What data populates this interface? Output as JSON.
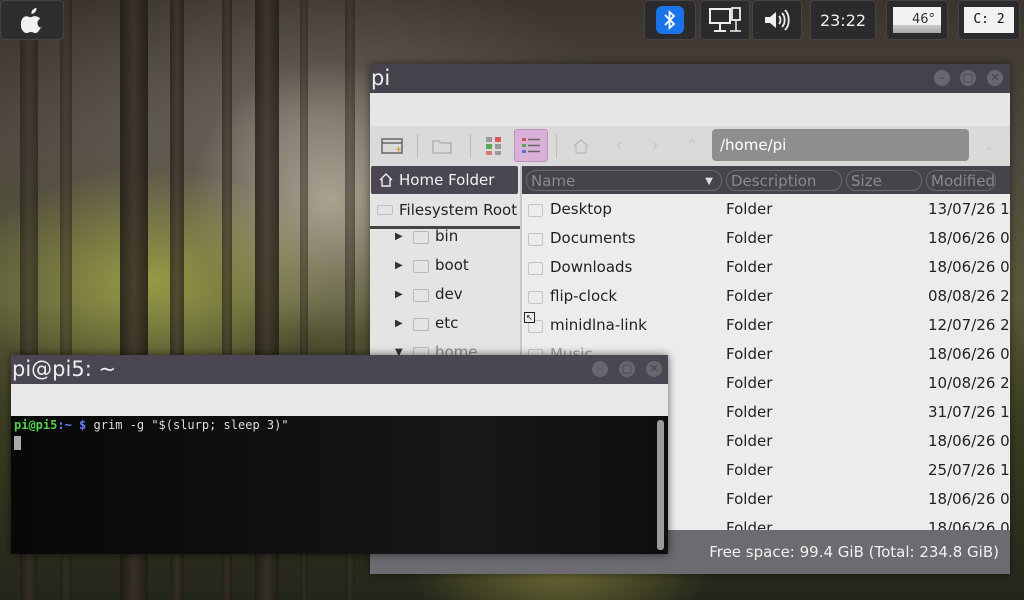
{
  "panel": {
    "menu_icon": "apple-logo-icon",
    "bluetooth_icon": "bluetooth-icon",
    "network_icon": "network-icon",
    "volume_icon": "volume-icon",
    "clock": "23:22",
    "temperature": "46°",
    "cpu_label": "C: 2",
    "accent": "#1a73e8"
  },
  "file_manager": {
    "title": "pi",
    "path": "/home/pi",
    "places": [
      {
        "label": "Home Folder",
        "icon": "home-icon"
      },
      {
        "label": "Filesystem Root",
        "icon": "drive-icon"
      }
    ],
    "tree": [
      {
        "label": "bin"
      },
      {
        "label": "boot"
      },
      {
        "label": "dev"
      },
      {
        "label": "etc"
      },
      {
        "label": "home"
      }
    ],
    "columns": {
      "name": "Name",
      "description": "Description",
      "size": "Size",
      "modified": "Modified"
    },
    "rows": [
      {
        "name": "Desktop",
        "description": "Folder",
        "modified": "13/07/26 1"
      },
      {
        "name": "Documents",
        "description": "Folder",
        "modified": "18/06/26 0"
      },
      {
        "name": "Downloads",
        "description": "Folder",
        "modified": "18/06/26 0"
      },
      {
        "name": "flip-clock",
        "description": "Folder",
        "modified": "08/08/26 2"
      },
      {
        "name": "minidlna-link",
        "description": "Folder",
        "modified": "12/07/26 2"
      },
      {
        "name": "Music",
        "description": "Folder",
        "modified": "18/06/26 0"
      },
      {
        "name": "",
        "description": "Folder",
        "modified": "10/08/26 2"
      },
      {
        "name": "",
        "description": "Folder",
        "modified": "31/07/26 1"
      },
      {
        "name": "",
        "description": "Folder",
        "modified": "18/06/26 0"
      },
      {
        "name": "",
        "description": "Folder",
        "modified": "25/07/26 1"
      },
      {
        "name": "",
        "description": "Folder",
        "modified": "18/06/26 0"
      },
      {
        "name": "",
        "description": "Folder",
        "modified": "18/06/26 0"
      }
    ],
    "status": "Free space: 99.4 GiB (Total: 234.8 GiB)"
  },
  "terminal": {
    "title": "pi@pi5: ~",
    "prompt_user": "pi@pi5",
    "prompt_path": ":~",
    "prompt_symbol": "$",
    "command": "grim -g \"$(slurp; sleep 3)\""
  }
}
